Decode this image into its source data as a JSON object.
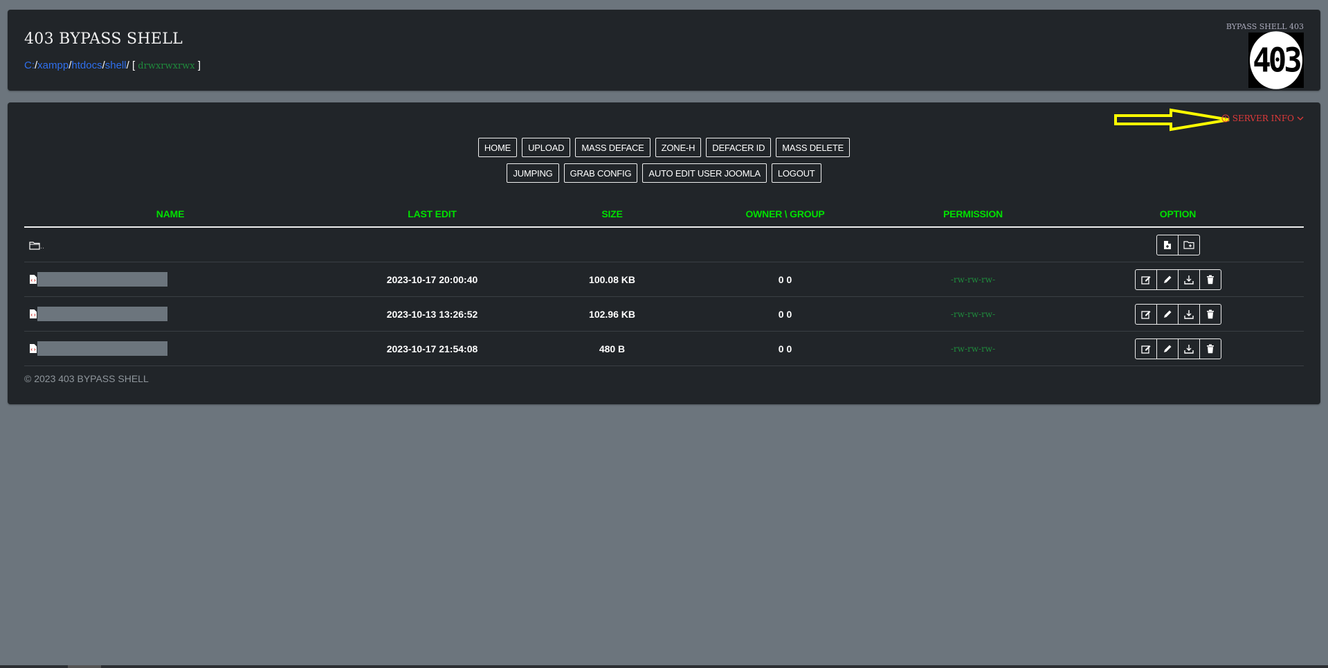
{
  "header": {
    "title": "403 BYPASS SHELL",
    "path": [
      {
        "label": "C:"
      },
      {
        "label": "xampp"
      },
      {
        "label": "htdocs"
      },
      {
        "label": "shell"
      }
    ],
    "path_sep": "/",
    "perm_open": "[",
    "perm": "drwxrwxrwx",
    "perm_close": "]",
    "brand_label": "BYPASS SHELL 403",
    "logo_text": "403"
  },
  "server_info": {
    "label": "SERVER INFO",
    "icon": "info-circle-icon",
    "color": "#e03a3a"
  },
  "nav": {
    "row1": [
      "HOME",
      "UPLOAD",
      "MASS DEFACE",
      "ZONE-H",
      "DEFACER ID",
      "MASS DELETE"
    ],
    "row2": [
      "JUMPING",
      "GRAB CONFIG",
      "AUTO EDIT USER JOOMLA",
      "LOGOUT"
    ]
  },
  "table": {
    "headers": [
      "NAME",
      "LAST EDIT",
      "SIZE",
      "OWNER \\ GROUP",
      "PERMISSION",
      "OPTION"
    ],
    "parent_label": "..",
    "rows": [
      {
        "name": "",
        "last_edit": "2023-10-17 20:00:40",
        "size": "100.08 KB",
        "owner": "0 0",
        "perm": "-rw-rw-rw-"
      },
      {
        "name": "",
        "last_edit": "2023-10-13 13:26:52",
        "size": "102.96 KB",
        "owner": "0 0",
        "perm": "-rw-rw-rw-"
      },
      {
        "name": "",
        "last_edit": "2023-10-17 21:54:08",
        "size": "480 B",
        "owner": "0 0",
        "perm": "-rw-rw-rw-"
      }
    ]
  },
  "footer": "© 2023 403 BYPASS SHELL",
  "colors": {
    "background": "#6c757d",
    "card": "#212529",
    "accent_green": "#00e000",
    "link_blue": "#2f6fed",
    "annotation_yellow": "#ffff00"
  }
}
